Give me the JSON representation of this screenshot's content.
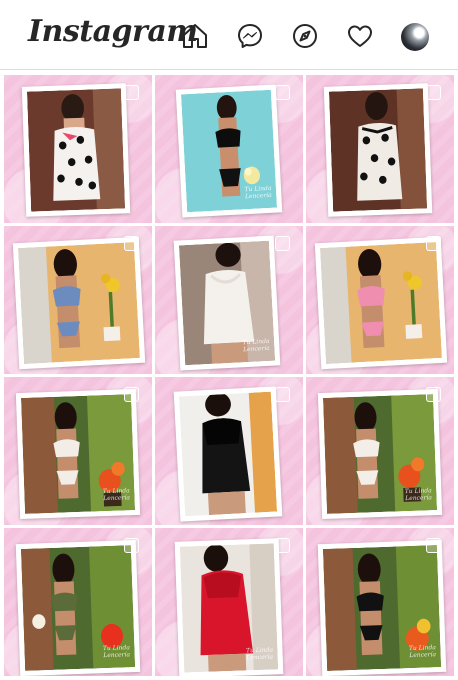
{
  "header": {
    "logo_text": "Instagram",
    "icons": [
      "home-icon",
      "messenger-icon",
      "explore-icon",
      "activity-heart-icon",
      "profile-avatar"
    ]
  },
  "colors": {
    "tile_background": "#f4c3de",
    "header_text": "#262626"
  },
  "posts": [
    {
      "id": 1,
      "outfit": "white-polka-dot-chemise",
      "watermark": ""
    },
    {
      "id": 2,
      "outfit": "black-lace-bra-set",
      "watermark": "Tu Linda Lencería"
    },
    {
      "id": 3,
      "outfit": "white-polka-dot-chemise",
      "watermark": ""
    },
    {
      "id": 4,
      "outfit": "blue-lace-set",
      "watermark": ""
    },
    {
      "id": 5,
      "outfit": "white-satin-babydoll",
      "watermark": "Tu Linda Lencería"
    },
    {
      "id": 6,
      "outfit": "pink-lace-set",
      "watermark": ""
    },
    {
      "id": 7,
      "outfit": "white-lace-set",
      "watermark": "Tu Linda Lencería"
    },
    {
      "id": 8,
      "outfit": "black-sheer-babydoll",
      "watermark": ""
    },
    {
      "id": 9,
      "outfit": "white-floral-set",
      "watermark": "Tu Linda Lencería"
    },
    {
      "id": 10,
      "outfit": "olive-lace-set",
      "watermark": "Tu Linda Lencería"
    },
    {
      "id": 11,
      "outfit": "red-babydoll",
      "watermark": "Tu Linda Lencería"
    },
    {
      "id": 12,
      "outfit": "black-lace-set",
      "watermark": "Tu Linda Lencería"
    }
  ]
}
